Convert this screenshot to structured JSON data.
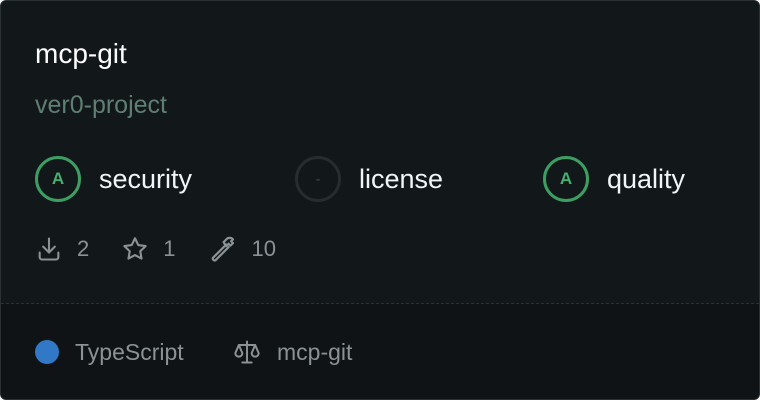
{
  "card": {
    "title": "mcp-git",
    "owner": "ver0-project"
  },
  "scores": [
    {
      "grade": "A",
      "label": "security",
      "status": "graded"
    },
    {
      "grade": "-",
      "label": "license",
      "status": "none"
    },
    {
      "grade": "A",
      "label": "quality",
      "status": "graded"
    }
  ],
  "stats": {
    "downloads": "2",
    "stars": "1",
    "tools": "10"
  },
  "footer": {
    "language": "TypeScript",
    "language_color": "#3178c6",
    "license_name": "mcp-git"
  },
  "colors": {
    "grade_a": "#46b070",
    "background": "#121719",
    "owner_text": "#5f7f72"
  }
}
